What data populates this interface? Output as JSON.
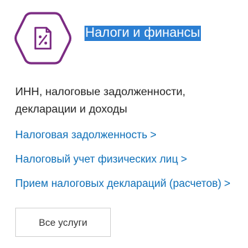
{
  "card": {
    "icon": "tax-document-percent-icon",
    "title": "Налоги и финансы",
    "description": "ИНН, налоговые задолженности, декларации и доходы",
    "links": [
      {
        "label": "Налоговая задолженность",
        "chevron": ">"
      },
      {
        "label": "Налоговый учет физических лиц",
        "chevron": ">"
      },
      {
        "label": "Прием налоговых деклараций (расчетов)",
        "chevron": ">"
      }
    ],
    "all_services_label": "Все услуги"
  },
  "colors": {
    "icon_purple": "#7b2a82",
    "link_blue": "#0d6fb8",
    "selection_blue": "#2b7fd3"
  }
}
